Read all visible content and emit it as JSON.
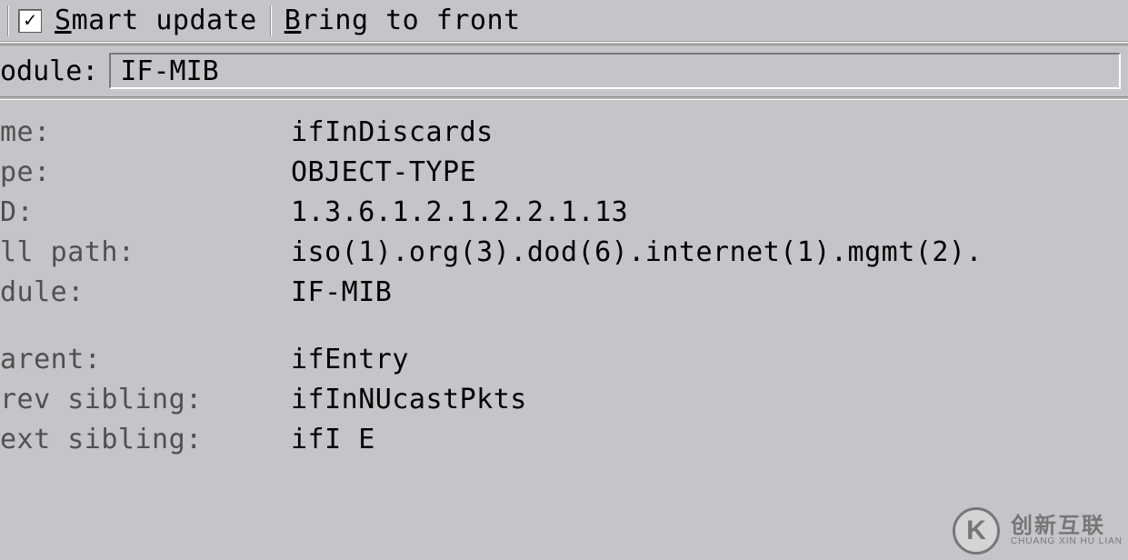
{
  "toolbar": {
    "smart_update_label": "Smart update",
    "smart_update_checked": true,
    "bring_to_front_label": "Bring to front"
  },
  "module_row": {
    "label": "odule:",
    "value": "IF-MIB"
  },
  "details": {
    "name": {
      "label": "me:",
      "value": "ifInDiscards"
    },
    "type": {
      "label": "pe:",
      "value": "OBJECT-TYPE"
    },
    "oid": {
      "label": "D:",
      "value": "1.3.6.1.2.1.2.2.1.13"
    },
    "full_path": {
      "label": "ll path:",
      "value": "iso(1).org(3).dod(6).internet(1).mgmt(2)."
    },
    "module": {
      "label": "dule:",
      "value": "IF-MIB"
    },
    "parent": {
      "label": "arent:",
      "value": "ifEntry"
    },
    "prev_sibling": {
      "label": "rev sibling:",
      "value": "ifInNUcastPkts"
    },
    "next_sibling": {
      "label": "ext sibling:",
      "value": "ifI E"
    }
  },
  "watermark": {
    "logo_letter": "K",
    "text_big": "创新互联",
    "text_small": "CHUANG XIN HU LIAN"
  }
}
